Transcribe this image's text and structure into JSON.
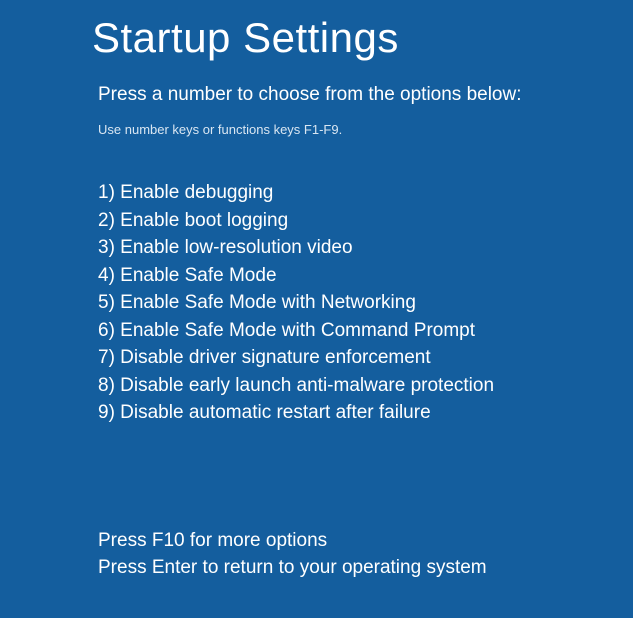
{
  "title": "Startup Settings",
  "instruction": "Press a number to choose from the options below:",
  "hint": "Use number keys or functions keys F1-F9.",
  "options": [
    "1) Enable debugging",
    "2) Enable boot logging",
    "3) Enable low-resolution video",
    "4) Enable Safe Mode",
    "5) Enable Safe Mode with Networking",
    "6) Enable Safe Mode with Command Prompt",
    "7) Disable driver signature enforcement",
    "8) Disable early launch anti-malware protection",
    "9) Disable automatic restart after failure"
  ],
  "footer": {
    "more": "Press F10 for more options",
    "return": "Press Enter to return to your operating system"
  }
}
